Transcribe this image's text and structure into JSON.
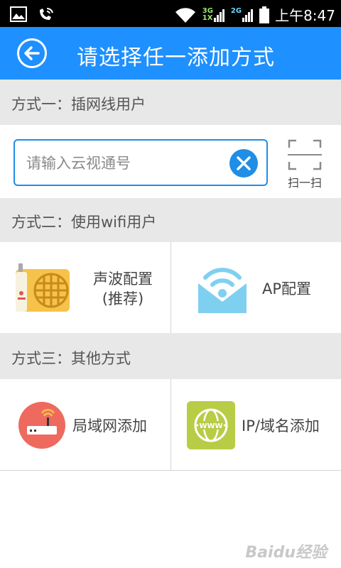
{
  "status_bar": {
    "net_3g": "3G",
    "net_1x": "1X",
    "net_2g": "2G",
    "time": "上午8:47",
    "icons": [
      "image-icon",
      "phone-wifi-icon",
      "wifi-icon",
      "signal-icon",
      "battery-icon"
    ]
  },
  "header": {
    "title": "请选择任一添加方式",
    "back_icon": "arrow-left-icon"
  },
  "section1": {
    "title": "方式一：插网线用户",
    "input_placeholder": "请输入云视通号",
    "scan_label": "扫一扫"
  },
  "section2": {
    "title": "方式二：使用wifi用户",
    "sound_line1": "声波配置",
    "sound_line2": "(推荐)",
    "ap_label": "AP配置"
  },
  "section3": {
    "title": "方式三：其他方式",
    "lan_label": "局域网添加",
    "ip_label": "IP/域名添加"
  },
  "colors": {
    "accent": "#1e90ff",
    "section_bg": "#e8e8e8",
    "sound_icon": "#f5c349",
    "ap_icon": "#7fd0f0",
    "lan_icon": "#ee6a5e",
    "ip_icon": "#b8cc45"
  },
  "watermark": "Baidu经验"
}
